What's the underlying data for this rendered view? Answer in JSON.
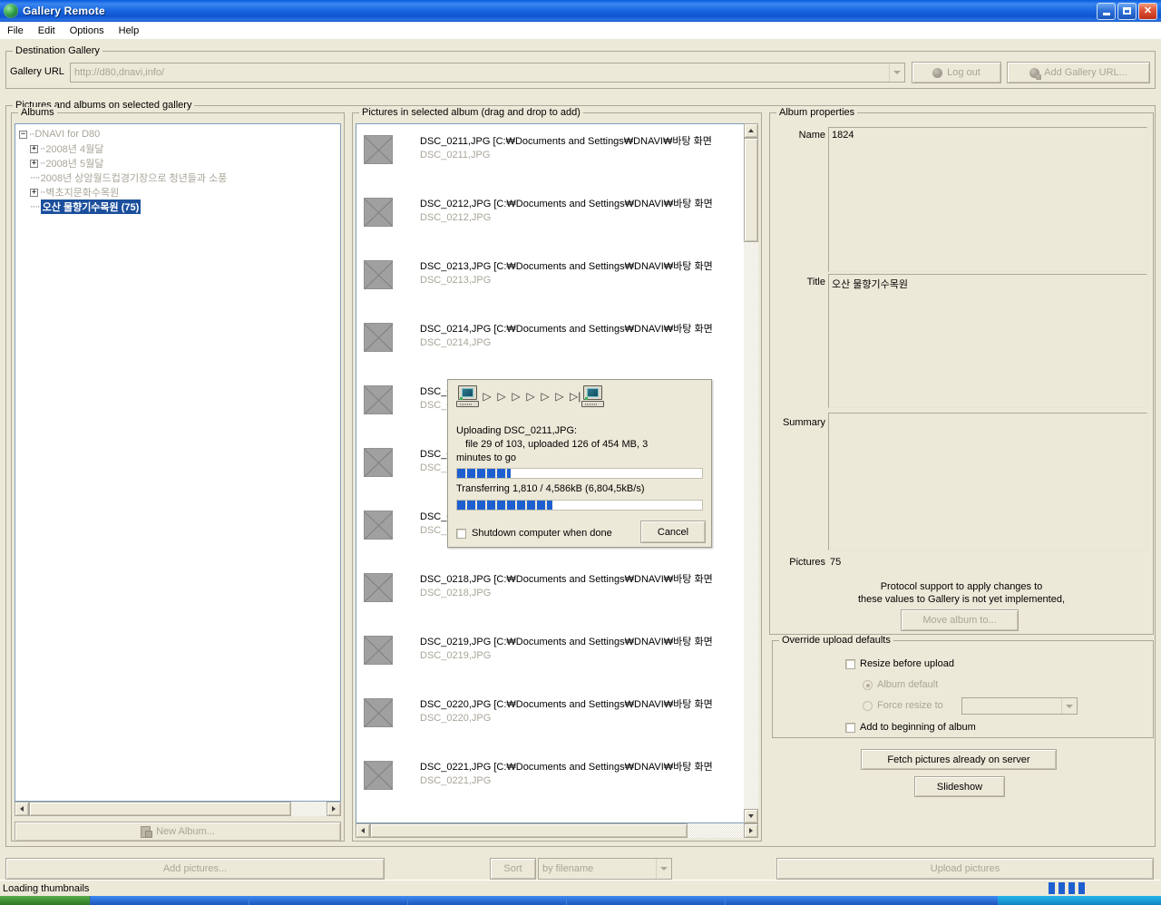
{
  "window": {
    "title": "Gallery Remote",
    "app_icon": "globe-icon",
    "minimize_label": "Minimize",
    "maximize_label": "Maximize",
    "close_label": "Close"
  },
  "menu": {
    "items": [
      {
        "label": "File"
      },
      {
        "label": "Edit"
      },
      {
        "label": "Options"
      },
      {
        "label": "Help"
      }
    ]
  },
  "destination": {
    "legend": "Destination Gallery",
    "url_label": "Gallery URL",
    "url_value": "http://d80,dnavi,info/",
    "logout_label": "Log out",
    "add_gallery_label": "Add Gallery URL..."
  },
  "gallery_panel": {
    "legend": "Pictures and albums on selected gallery"
  },
  "albums": {
    "header": "Albums",
    "new_album_label": "New Album...",
    "tree": [
      {
        "label": "DNAVI for D80",
        "indent": 0,
        "expander": "-",
        "selected": false
      },
      {
        "label": "2008년 4월달",
        "indent": 1,
        "expander": "+",
        "selected": false
      },
      {
        "label": "2008년 5월달",
        "indent": 1,
        "expander": "+",
        "selected": false
      },
      {
        "label": "2008년 상암월드컵경기장으로 청년들과 소풍",
        "indent": 1,
        "expander": "",
        "selected": false
      },
      {
        "label": "벽초지문화수목원",
        "indent": 1,
        "expander": "+",
        "selected": false
      },
      {
        "label": "오산 물향기수목원 (75)",
        "indent": 1,
        "expander": "",
        "selected": true
      }
    ]
  },
  "pictures": {
    "header": "Pictures in selected album (drag and drop to add)",
    "path_suffix": "[C:₩Documents and Settings₩DNAVI₩바탕 화면",
    "rows": [
      {
        "name": "DSC_0211,JPG",
        "sub": "DSC_0211,JPG"
      },
      {
        "name": "DSC_0212,JPG",
        "sub": "DSC_0212,JPG"
      },
      {
        "name": "DSC_0213,JPG",
        "sub": "DSC_0213,JPG"
      },
      {
        "name": "DSC_0214,JPG",
        "sub": "DSC_0214,JPG"
      },
      {
        "name": "DSC_0215,JPG",
        "sub": "DSC_0215,JPG"
      },
      {
        "name": "DSC_0216,JPG",
        "sub": "DSC_0216,JPG"
      },
      {
        "name": "DSC_0217,JPG",
        "sub": "DSC_0217,JPG"
      },
      {
        "name": "DSC_0218,JPG",
        "sub": "DSC_0218,JPG"
      },
      {
        "name": "DSC_0219,JPG",
        "sub": "DSC_0219,JPG"
      },
      {
        "name": "DSC_0220,JPG",
        "sub": "DSC_0220,JPG"
      },
      {
        "name": "DSC_0221,JPG",
        "sub": "DSC_0221,JPG"
      }
    ]
  },
  "album_properties": {
    "legend": "Album properties",
    "name_label": "Name",
    "name_value": "1824",
    "title_label": "Title",
    "title_value": "오산 물향기수목원",
    "summary_label": "Summary",
    "summary_value": "",
    "pictures_label": "Pictures",
    "pictures_value": "75",
    "notice_line1": "Protocol support to apply changes to",
    "notice_line2": "these values to Gallery is not yet implemented,",
    "move_album_label": "Move album to..."
  },
  "override": {
    "legend": "Override upload defaults",
    "resize_label": "Resize before upload",
    "resize_checked": false,
    "album_default_label": "Album default",
    "album_default_selected": true,
    "force_resize_label": "Force resize to",
    "force_resize_selected": false,
    "force_resize_value": "",
    "add_beginning_label": "Add to beginning of album",
    "add_beginning_checked": false
  },
  "right_actions": {
    "fetch_label": "Fetch pictures already on server",
    "slideshow_label": "Slideshow"
  },
  "bottom_bar": {
    "add_pictures_label": "Add pictures...",
    "sort_label": "Sort",
    "sort_value": "by filename",
    "upload_label": "Upload pictures"
  },
  "status": {
    "text": "Loading thumbnails",
    "progress_percent": 35
  },
  "upload_dialog": {
    "title_icons": [
      "computer-icon",
      "computer-icon"
    ],
    "arrows": [
      "▷",
      "▷",
      "▷",
      "▷",
      "▷",
      "▷",
      "▷|"
    ],
    "line1": "Uploading DSC_0211,JPG:",
    "line2": "file 29 of 103, uploaded 126 of 454 MB, 3",
    "line3": "minutes to go",
    "overall_progress_percent": 22,
    "transfer_text": "Transferring 1,810 / 4,586kB (6,804,5kB/s)",
    "transfer_progress_percent": 39,
    "shutdown_label": "Shutdown computer when done",
    "shutdown_checked": false,
    "cancel_label": "Cancel"
  },
  "colors": {
    "titlebar_blue": "#1b6ae2",
    "face": "#ece9d8",
    "selection_blue": "#1b4f9c",
    "progress_blue": "#1e5fd0",
    "disabled_text": "#a9a598"
  }
}
